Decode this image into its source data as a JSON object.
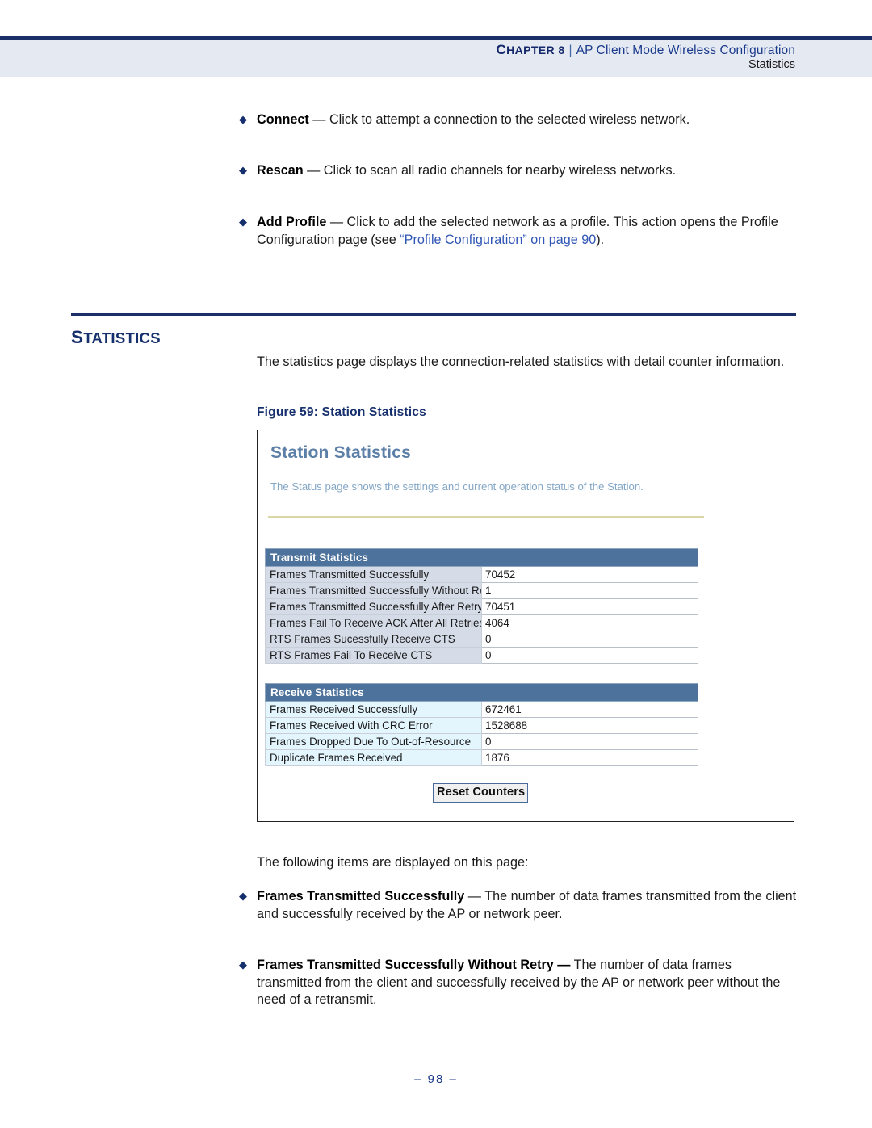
{
  "header": {
    "chapter_label": "CHAPTER 8",
    "separator": "|",
    "chapter_title": "AP Client Mode Wireless Configuration",
    "subtitle": "Statistics"
  },
  "bullets_top": [
    {
      "term": "Connect",
      "dash": " — ",
      "text": "Click to attempt a connection to the selected wireless network."
    },
    {
      "term": "Rescan",
      "dash": " — ",
      "text": "Click to scan all radio channels for nearby wireless networks."
    },
    {
      "term": "Add Profile",
      "dash": " — ",
      "text_before_link": "Click to add the selected network as a profile. This action opens the Profile Configuration page (see ",
      "link_text": "“Profile Configuration” on page 90",
      "text_after_link": ")."
    }
  ],
  "section": {
    "title_cap": "S",
    "title_rest": "TATISTICS",
    "intro": "The statistics page displays the connection-related statistics with detail counter information."
  },
  "figure": {
    "caption": "Figure 59:  Station Statistics",
    "app_title": "Station Statistics",
    "app_description": "The Status page shows the settings and current operation status of the Station.",
    "reset_button_label": "Reset Counters",
    "groups": [
      {
        "name": "Transmit Statistics",
        "style": "tx",
        "rows": [
          {
            "label": "Frames Transmitted Successfully",
            "value": "70452"
          },
          {
            "label": "Frames Transmitted Successfully Without Retry",
            "value": "1"
          },
          {
            "label": "Frames Transmitted Successfully After Retry(s)",
            "value": "70451"
          },
          {
            "label": "Frames Fail To Receive ACK After All Retries",
            "value": "4064"
          },
          {
            "label": "RTS Frames Sucessfully Receive CTS",
            "value": "0"
          },
          {
            "label": "RTS Frames Fail To Receive CTS",
            "value": "0"
          }
        ]
      },
      {
        "name": "Receive Statistics",
        "style": "rx",
        "rows": [
          {
            "label": "Frames Received Successfully",
            "value": "672461"
          },
          {
            "label": "Frames Received With CRC Error",
            "value": "1528688"
          },
          {
            "label": "Frames Dropped Due To Out-of-Resource",
            "value": "0"
          },
          {
            "label": "Duplicate Frames Received",
            "value": "1876"
          }
        ]
      }
    ]
  },
  "body": {
    "following_items": "The following items are displayed on this page:"
  },
  "bullets_bottom": [
    {
      "term": "Frames Transmitted Successfully",
      "dash": " — ",
      "text": "The number of data frames transmitted from the client and successfully received by the AP or network peer."
    },
    {
      "term": "Frames Transmitted Successfully Without Retry —",
      "dash": " ",
      "text": "The number of data frames transmitted from the client and successfully received by the AP or network peer without the need of a retransmit."
    }
  ],
  "footer": {
    "page_number": "–  98  –"
  },
  "colors": {
    "navy": "#16306e",
    "header_band": "#e4e9f2",
    "link": "#2f55b5",
    "table_header": "#4d729b",
    "tx_row": "#d5dce8",
    "rx_row": "#e3f5fd",
    "rule_tan": "#d9d7a8"
  }
}
